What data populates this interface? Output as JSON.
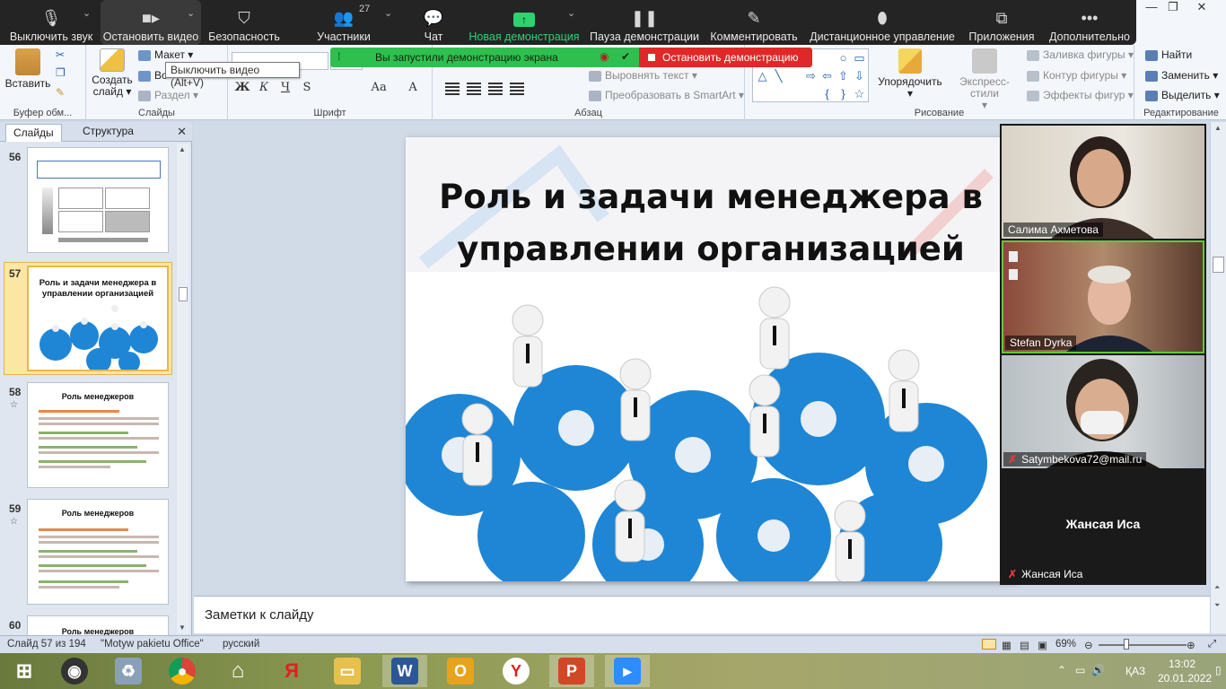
{
  "zoom_toolbar": {
    "items": [
      {
        "label": "Выключить звук",
        "icon": "microphone-icon"
      },
      {
        "label": "Остановить видео",
        "icon": "video-camera-icon"
      },
      {
        "label": "Безопасность",
        "icon": "shield-icon"
      },
      {
        "label": "Участники",
        "icon": "participants-icon",
        "count": "27"
      },
      {
        "label": "Чат",
        "icon": "chat-icon"
      },
      {
        "label": "Новая демонстрация",
        "icon": "share-screen-icon"
      },
      {
        "label": "Пауза демонстрации",
        "icon": "pause-icon"
      },
      {
        "label": "Комментировать",
        "icon": "pencil-icon"
      },
      {
        "label": "Дистанционное управление",
        "icon": "mouse-icon"
      },
      {
        "label": "Приложения",
        "icon": "apps-icon"
      },
      {
        "label": "Дополнительно",
        "icon": "more-icon"
      }
    ],
    "share_banner": "Вы запустили демонстрацию экрана",
    "stop_share": "Остановить демонстрацию",
    "accent_green": "#2fbf4f",
    "stop_red": "#e02828"
  },
  "tooltip": "Выключить видео (Alt+V)",
  "ribbon": {
    "clipboard": {
      "paste": "Вставить",
      "label": "Буфер обм..."
    },
    "slides": {
      "create": "Создать",
      "create2": "слайд",
      "layout": "Макет",
      "reset": "Во",
      "section": "Раздел",
      "label": "Слайды"
    },
    "font": {
      "label": "Шрифт",
      "bold": "Ж",
      "italic": "К",
      "underline": "Ч",
      "strike": "S",
      "case": "Аа",
      "color": "А"
    },
    "paragraph": {
      "label": "Абзац",
      "align_text": "Выровнять текст",
      "smartart": "Преобразовать в SmartArt"
    },
    "drawing": {
      "label": "Рисование",
      "arrange": "Упорядочить",
      "quick_styles": "Экспресс-стили",
      "fill": "Заливка фигуры",
      "outline": "Контур фигуры",
      "effects": "Эффекты фигур"
    },
    "editing": {
      "label": "Редактирование",
      "find": "Найти",
      "replace": "Заменить",
      "select": "Выделить"
    }
  },
  "slides_panel": {
    "tabs": [
      "Слайды",
      "Структура"
    ],
    "thumbnails": [
      {
        "number": "56",
        "title": ""
      },
      {
        "number": "57",
        "title": "Роль и задачи менеджера в управлении организацией"
      },
      {
        "number": "58",
        "title": "Роль менеджеров"
      },
      {
        "number": "59",
        "title": "Роль менеджеров"
      },
      {
        "number": "60",
        "title": "Роль менеджеров"
      }
    ]
  },
  "slide": {
    "title": "Роль и задачи менеджера в управлении организацией"
  },
  "notes_placeholder": "Заметки к слайду",
  "gallery": [
    {
      "name": "Салима Ахметова",
      "muted": false
    },
    {
      "name": "Stefan Dyrka",
      "muted": false,
      "speaking": true
    },
    {
      "name": "Satymbekova72@mail.ru",
      "muted": true
    },
    {
      "name": "Жансая Иса",
      "muted": true,
      "video_off": true
    }
  ],
  "status_bar": {
    "slide_info": "Слайд 57 из 194",
    "theme": "\"Motyw pakietu Office\"",
    "language": "русский",
    "zoom": "69%"
  },
  "taskbar": {
    "language": "ҚАЗ",
    "time": "13:02",
    "date": "20.01.2022"
  }
}
